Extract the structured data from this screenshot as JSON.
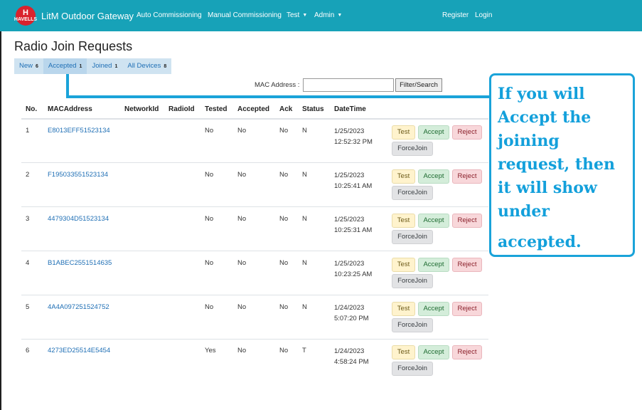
{
  "navbar": {
    "logo_text": "HAVELLS",
    "brand": "LitM Outdoor Gateway",
    "links": [
      "Auto Commissioning",
      "Manual Commissioning",
      "Test",
      "Admin"
    ],
    "register": "Register",
    "login": "Login"
  },
  "page_title": "Radio Join Requests",
  "tabs": [
    {
      "label": "New",
      "count": "6"
    },
    {
      "label": "Accepted",
      "count": "1"
    },
    {
      "label": "Joined",
      "count": "1"
    },
    {
      "label": "All Devices",
      "count": "8"
    }
  ],
  "filter": {
    "label": "MAC Address :",
    "value": "",
    "button": "Filter/Search"
  },
  "table": {
    "headers": [
      "No.",
      "MACAddress",
      "NetworkId",
      "RadioId",
      "Tested",
      "Accepted",
      "Ack",
      "Status",
      "DateTime"
    ],
    "rows": [
      {
        "no": "1",
        "mac": "E8013EFF51523134",
        "network": "",
        "radio": "",
        "tested": "No",
        "accepted": "No",
        "ack": "No",
        "status": "N",
        "date": "1/25/2023",
        "time": "12:52:32 PM"
      },
      {
        "no": "2",
        "mac": "F195033551523134",
        "network": "",
        "radio": "",
        "tested": "No",
        "accepted": "No",
        "ack": "No",
        "status": "N",
        "date": "1/25/2023",
        "time": "10:25:41 AM"
      },
      {
        "no": "3",
        "mac": "4479304D51523134",
        "network": "",
        "radio": "",
        "tested": "No",
        "accepted": "No",
        "ack": "No",
        "status": "N",
        "date": "1/25/2023",
        "time": "10:25:31 AM"
      },
      {
        "no": "4",
        "mac": "B1ABEC2551514635",
        "network": "",
        "radio": "",
        "tested": "No",
        "accepted": "No",
        "ack": "No",
        "status": "N",
        "date": "1/25/2023",
        "time": "10:23:25 AM"
      },
      {
        "no": "5",
        "mac": "4A4A097251524752",
        "network": "",
        "radio": "",
        "tested": "No",
        "accepted": "No",
        "ack": "No",
        "status": "N",
        "date": "1/24/2023",
        "time": "5:07:20 PM"
      },
      {
        "no": "6",
        "mac": "4273ED25514E5454",
        "network": "",
        "radio": "",
        "tested": "Yes",
        "accepted": "No",
        "ack": "No",
        "status": "T",
        "date": "1/24/2023",
        "time": "4:58:24 PM"
      }
    ],
    "actions": {
      "test": "Test",
      "accept": "Accept",
      "reject": "Reject",
      "force": "ForceJoin"
    }
  },
  "annotation": {
    "lines": [
      "If you will",
      "Accept the",
      "joining",
      "request, then",
      "it will show",
      "under",
      "accepted."
    ]
  },
  "colors": {
    "navbar": "#17a2b8",
    "link": "#1f6fb5",
    "annotation": "#13a0db"
  }
}
